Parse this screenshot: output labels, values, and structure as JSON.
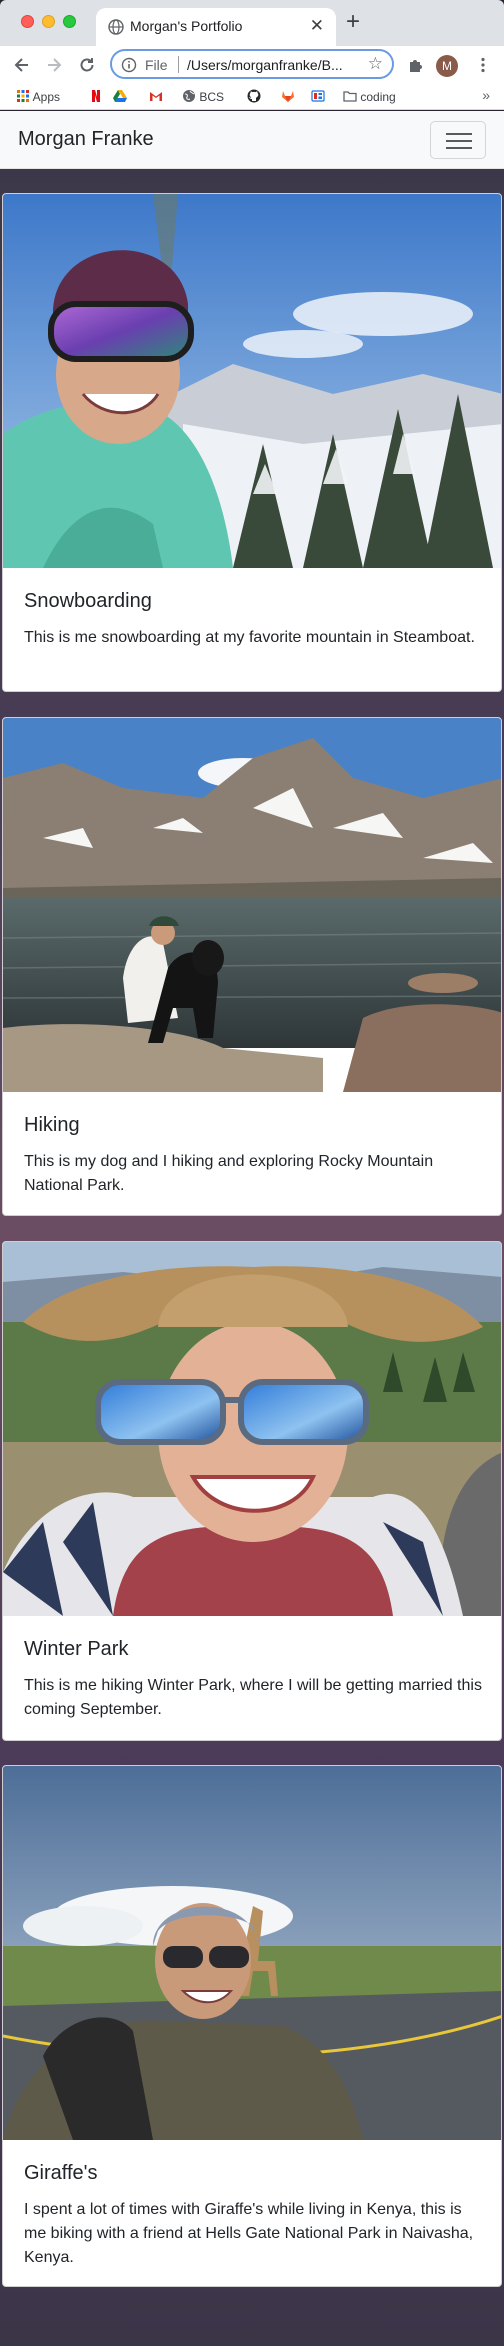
{
  "browser": {
    "tab_title": "Morgan's Portfolio",
    "omnibox": {
      "scheme_label": "File",
      "url": "/Users/morganfranke/B..."
    },
    "profile_initial": "M",
    "bookmarks": [
      {
        "label": "Apps",
        "icon": "apps-grid-icon"
      },
      {
        "label": "",
        "icon": "netflix-icon"
      },
      {
        "label": "",
        "icon": "google-drive-icon"
      },
      {
        "label": "",
        "icon": "gmail-icon"
      },
      {
        "label": "BCS",
        "icon": "globe-icon"
      },
      {
        "label": "",
        "icon": "github-icon"
      },
      {
        "label": "",
        "icon": "gitlab-icon"
      },
      {
        "label": "",
        "icon": "bookmark-app-icon"
      },
      {
        "label": "coding",
        "icon": "folder-icon"
      }
    ],
    "bookmarks_more": "»"
  },
  "navbar": {
    "brand": "Morgan Franke"
  },
  "cards": [
    {
      "title": "Snowboarding",
      "text": "This is me snowboarding at my favorite mountain in Steamboat.",
      "image": "photo of person in purple helmet and goggles on snowy mountain"
    },
    {
      "title": "Hiking",
      "text": "This is my dog and I hiking and exploring Rocky Mountain National Park.",
      "image": "photo of person and black dog by a mountain lake"
    },
    {
      "title": "Winter Park",
      "text": "This is me hiking Winter Park, where I will be getting married this coming September.",
      "image": "selfie in straw hat and mirrored sunglasses"
    },
    {
      "title": "Giraffe's",
      "text": "I spent a lot of times with Giraffe's while living in Kenya, this is me biking with a friend at Hells Gate National Park in Naivasha, Kenya.",
      "image": "selfie biking with giraffe in background"
    }
  ]
}
